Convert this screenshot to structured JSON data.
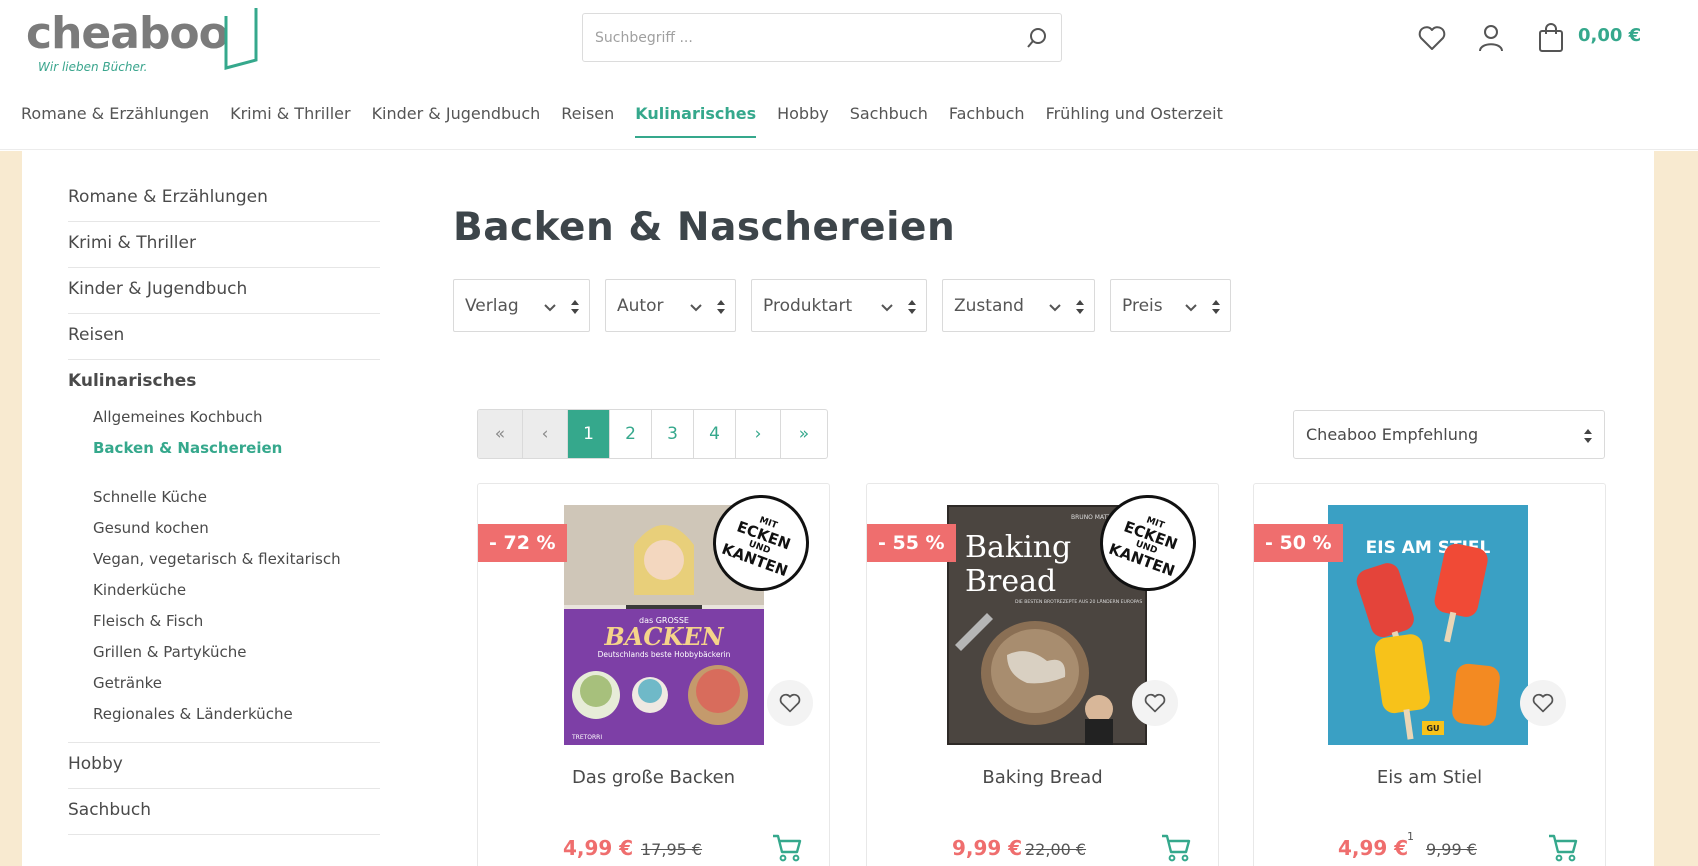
{
  "brand": {
    "name": "cheaboo",
    "tagline": "Wir lieben Bücher."
  },
  "search": {
    "placeholder": "Suchbegriff ..."
  },
  "header": {
    "cart_total": "0,00 €"
  },
  "main_nav": [
    {
      "label": "Romane & Erzählungen",
      "active": false
    },
    {
      "label": "Krimi & Thriller",
      "active": false
    },
    {
      "label": "Kinder & Jugendbuch",
      "active": false
    },
    {
      "label": "Reisen",
      "active": false
    },
    {
      "label": "Kulinarisches",
      "active": true
    },
    {
      "label": "Hobby",
      "active": false
    },
    {
      "label": "Sachbuch",
      "active": false
    },
    {
      "label": "Fachbuch",
      "active": false
    },
    {
      "label": "Frühling und Osterzeit",
      "active": false
    }
  ],
  "sidebar": {
    "top_items": [
      "Romane & Erzählungen",
      "Krimi & Thriller",
      "Kinder & Jugendbuch",
      "Reisen"
    ],
    "current_category": "Kulinarisches",
    "sub_items": [
      {
        "label": "Allgemeines Kochbuch",
        "active": false
      },
      {
        "label": "Backen & Naschereien",
        "active": true
      },
      {
        "label": "Schnelle Küche",
        "active": false
      },
      {
        "label": "Gesund kochen",
        "active": false
      },
      {
        "label": "Vegan, vegetarisch & flexitarisch",
        "active": false
      },
      {
        "label": "Kinderküche",
        "active": false
      },
      {
        "label": "Fleisch & Fisch",
        "active": false
      },
      {
        "label": "Grillen & Partyküche",
        "active": false
      },
      {
        "label": "Getränke",
        "active": false
      },
      {
        "label": "Regionales & Länderküche",
        "active": false
      }
    ],
    "bottom_items": [
      "Hobby",
      "Sachbuch"
    ]
  },
  "page": {
    "title": "Backen & Naschereien"
  },
  "filters": [
    "Verlag",
    "Autor",
    "Produktart",
    "Zustand",
    "Preis"
  ],
  "pagination": {
    "first": "«",
    "prev": "‹",
    "pages": [
      "1",
      "2",
      "3",
      "4"
    ],
    "current_page": "1",
    "next": "›",
    "last": "»"
  },
  "sort": {
    "selected": "Cheaboo Empfehlung"
  },
  "stamp": {
    "line1": "MIT",
    "line2": "ECKEN",
    "line3": "UND",
    "line4": "KANTEN"
  },
  "products": [
    {
      "title": "Das große Backen",
      "discount": "- 72 %",
      "price": "4,99 €",
      "old_price": "17,95 €",
      "footnote": "",
      "stamp": true,
      "cover": {
        "top_text": "das GROSSE",
        "main_text": "BACKEN",
        "sub_text": "Deutschlands beste Hobbybäckerin",
        "publisher": "TRETORRI",
        "color": "#7d3fa6"
      }
    },
    {
      "title": "Baking Bread",
      "discount": "- 55 %",
      "price": "9,99 €",
      "old_price": "22,00 €",
      "footnote": "",
      "stamp": true,
      "cover": {
        "top_text": "BRUNO MATTHES",
        "main_text_1": "Baking",
        "main_text_2": "Bread",
        "sub_text": "DIE BESTEN BROTREZEPTE AUS 20 LÄNDERN EUROPAS",
        "color": "#4b4540"
      }
    },
    {
      "title": "Eis am Stiel",
      "discount": "- 50 %",
      "price": "4,99 €",
      "old_price": "9,99 €",
      "footnote": "1",
      "stamp": false,
      "cover": {
        "main_text": "EIS AM STIEL",
        "publisher": "GU",
        "color": "#3aa0c4"
      }
    }
  ],
  "colors": {
    "accent": "#35a88c",
    "sale": "#ef6e6e",
    "text": "#4a4a4a",
    "side_bg": "#f8ead0"
  }
}
